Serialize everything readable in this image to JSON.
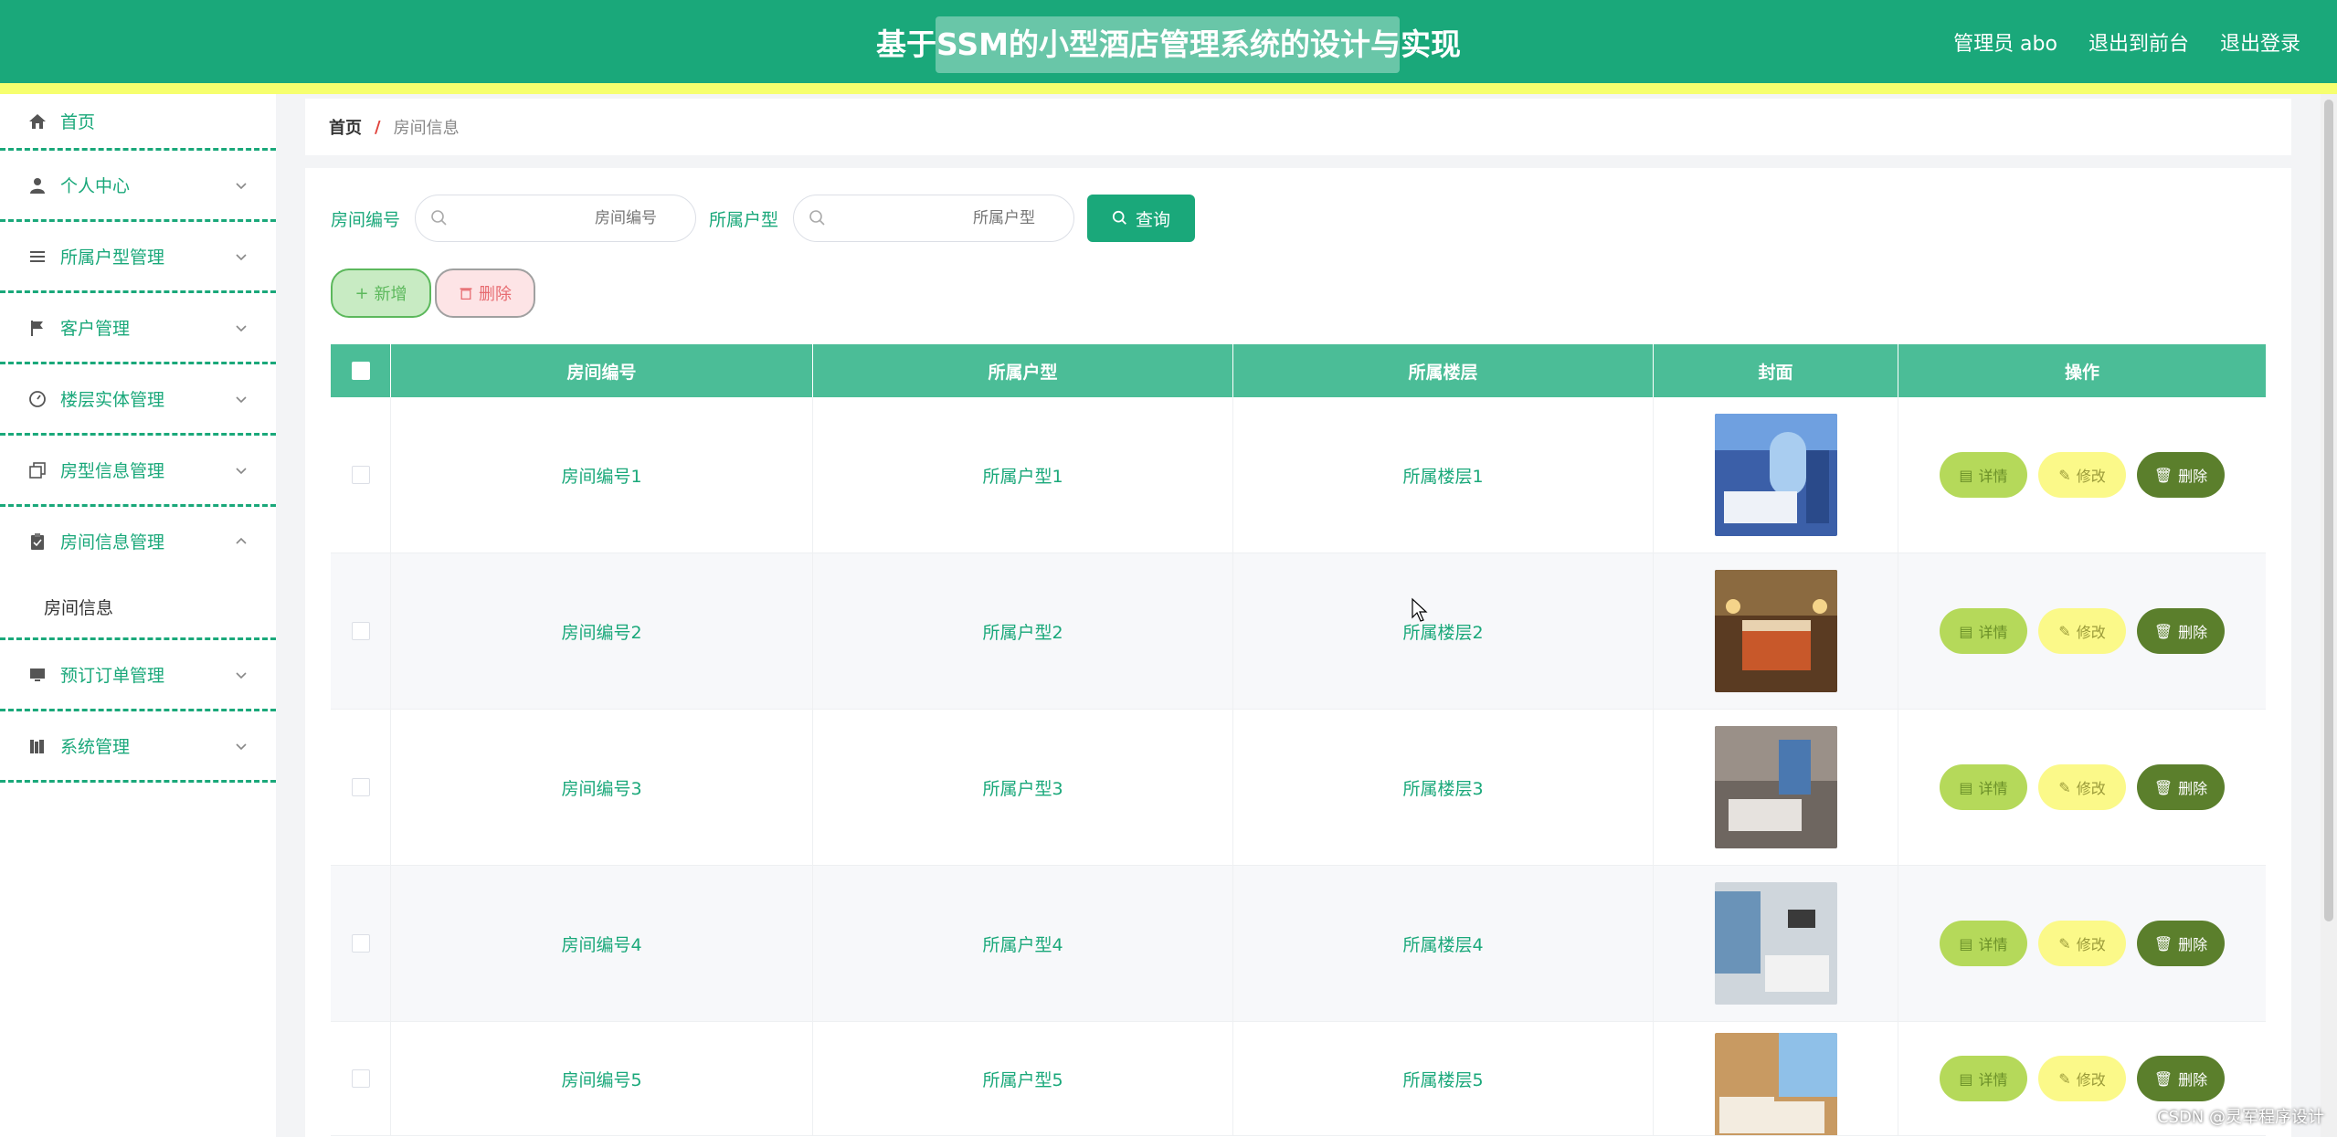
{
  "header": {
    "title": "基于SSM的小型酒店管理系统的设计与实现",
    "user": "管理员 abo",
    "front": "退出到前台",
    "logout": "退出登录"
  },
  "sidebar": {
    "items": [
      {
        "label": "首页",
        "icon": "home-icon"
      },
      {
        "label": "个人中心",
        "icon": "user-icon"
      },
      {
        "label": "所属户型管理",
        "icon": "list-icon"
      },
      {
        "label": "客户管理",
        "icon": "flag-icon"
      },
      {
        "label": "楼层实体管理",
        "icon": "gauge-icon"
      },
      {
        "label": "房型信息管理",
        "icon": "copy-icon"
      },
      {
        "label": "房间信息管理",
        "icon": "clipboard-icon"
      },
      {
        "label": "预订订单管理",
        "icon": "monitor-icon"
      },
      {
        "label": "系统管理",
        "icon": "books-icon"
      }
    ],
    "submenu": "房间信息"
  },
  "breadcrumb": {
    "home": "首页",
    "sep": "/",
    "current": "房间信息"
  },
  "search": {
    "room_label": "房间编号",
    "room_placeholder": "房间编号",
    "type_label": "所属户型",
    "type_placeholder": "所属户型",
    "query": "查询"
  },
  "actions": {
    "add": "新增",
    "delete": "删除"
  },
  "table": {
    "headers": [
      "房间编号",
      "所属户型",
      "所属楼层",
      "封面",
      "操作"
    ],
    "rows": [
      {
        "no": "房间编号1",
        "type": "所属户型1",
        "floor": "所属楼层1"
      },
      {
        "no": "房间编号2",
        "type": "所属户型2",
        "floor": "所属楼层2"
      },
      {
        "no": "房间编号3",
        "type": "所属户型3",
        "floor": "所属楼层3"
      },
      {
        "no": "房间编号4",
        "type": "所属户型4",
        "floor": "所属楼层4"
      },
      {
        "no": "房间编号5",
        "type": "所属户型5",
        "floor": "所属楼层5"
      }
    ],
    "op_labels": {
      "detail": "详情",
      "edit": "修改",
      "delete": "删除"
    }
  },
  "watermark": "CSDN @灵军程序设计",
  "colors": {
    "primary": "#1aa87a",
    "accent_bar": "#f6ff6e",
    "table_head": "#4bbd97"
  }
}
